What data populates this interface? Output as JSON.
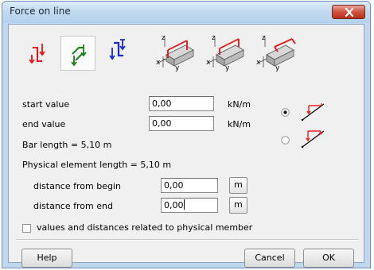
{
  "window": {
    "title": "Force on line",
    "close_icon": "close-x-icon",
    "accent_close": "#c9452f"
  },
  "toolbar": {
    "tools": [
      {
        "name": "force-red-icon",
        "selected": false
      },
      {
        "name": "force-green-icon",
        "selected": true
      },
      {
        "name": "force-blue-icon",
        "selected": false
      },
      {
        "name": "beam-load-xz-icon",
        "selected": false
      },
      {
        "name": "beam-load-z-icon",
        "selected": false
      },
      {
        "name": "beam-load-y-icon",
        "selected": false
      }
    ],
    "axis_labels": {
      "z": "z",
      "x": "x",
      "y": "y"
    }
  },
  "form": {
    "start_value": {
      "label": "start value",
      "value": "0,00",
      "unit": "kN/m"
    },
    "end_value": {
      "label": "end value",
      "value": "0,00",
      "unit": "kN/m"
    },
    "bar_length": "Bar length = 5,10 m",
    "physical_length": "Physical element length = 5,10 m",
    "distance_begin": {
      "label": "distance from begin",
      "value": "0,00",
      "unit_button": "m"
    },
    "distance_end": {
      "label": "distance from end",
      "value": "0,00",
      "unit_button": "m"
    },
    "distribution": {
      "options": [
        "uniform",
        "trapezoidal"
      ],
      "selected": "uniform"
    },
    "related_checkbox": {
      "label": "values and distances related to physical member",
      "checked": false
    }
  },
  "buttons": {
    "help": {
      "label": "Help",
      "mnemonic": "H"
    },
    "cancel": {
      "label": "Cancel",
      "mnemonic": "C"
    },
    "ok": {
      "label": "OK",
      "mnemonic": "O"
    }
  }
}
